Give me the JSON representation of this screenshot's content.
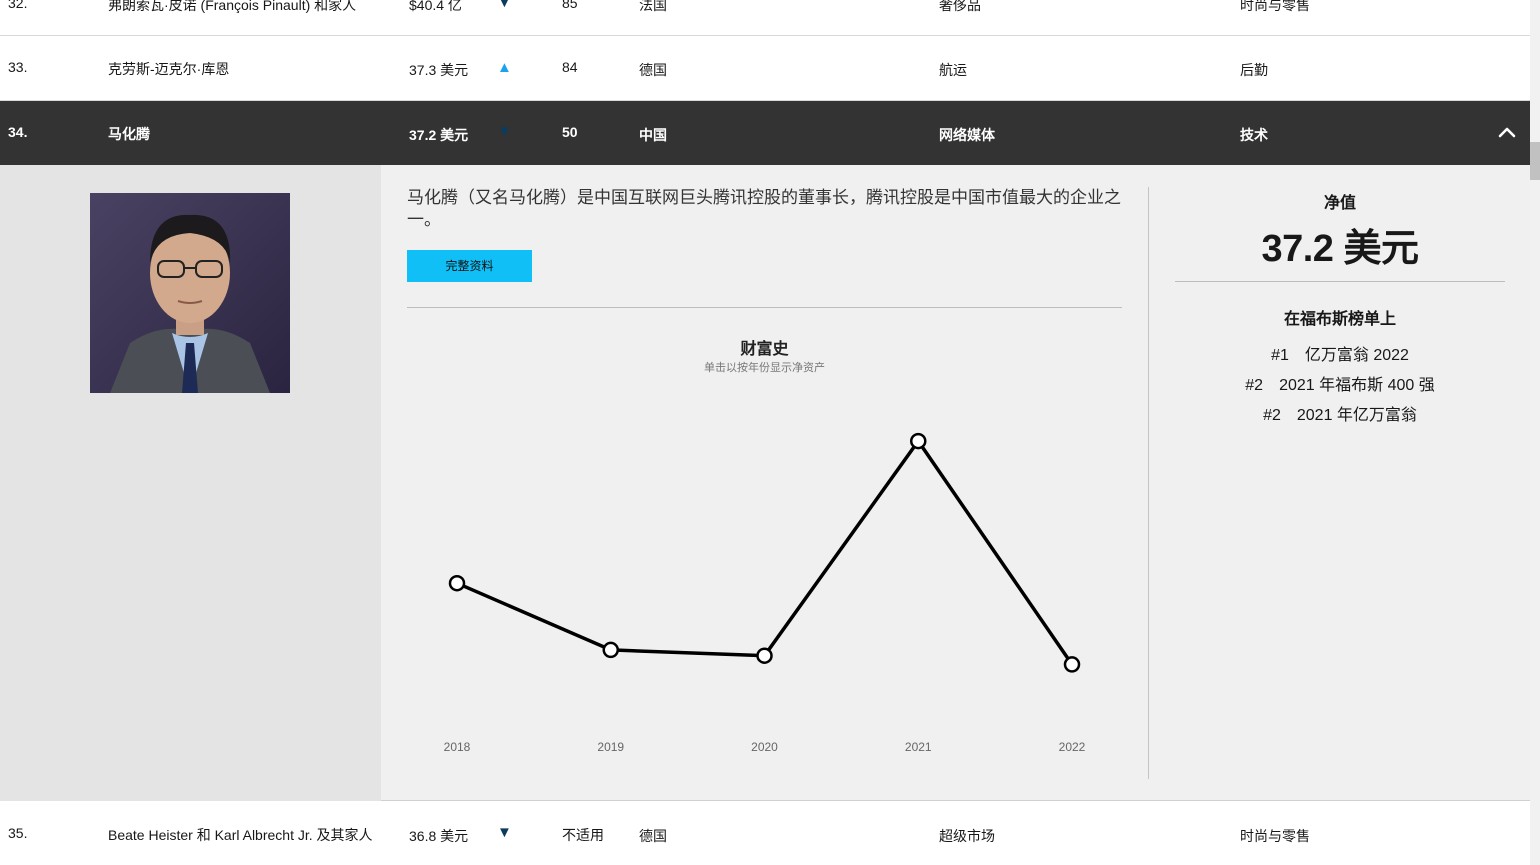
{
  "rows": [
    {
      "rank": "32.",
      "name": "弗朗索瓦·皮诺 (François Pinault) 和家人",
      "worth": "$40.4 亿",
      "trend": "▼",
      "age": "85",
      "country": "法国",
      "source": "奢侈品",
      "industry": "时尚与零售"
    },
    {
      "rank": "33.",
      "name": "克劳斯-迈克尔·库恩",
      "worth": "37.3 美元",
      "trend": "▲",
      "age": "84",
      "country": "德国",
      "source": "航运",
      "industry": "后勤"
    },
    {
      "rank": "34.",
      "name": "马化腾",
      "worth": "37.2 美元",
      "trend": "▼",
      "age": "50",
      "country": "中国",
      "source": "网络媒体",
      "industry": "技术"
    },
    {
      "rank": "35.",
      "name": "Beate Heister 和 Karl Albrecht Jr. 及其家人",
      "worth": "36.8 美元",
      "trend": "▼",
      "age": "不适用",
      "country": "德国",
      "source": "超级市场",
      "industry": "时尚与零售"
    }
  ],
  "detail": {
    "bio": "马化腾（又名马化腾）是中国互联网巨头腾讯控股的董事长，腾讯控股是中国市值最大的企业之一。",
    "profile_button": "完整资料",
    "net_worth_label": "净值",
    "net_worth_value": "37.2 美元",
    "rankings_heading": "在福布斯榜单上",
    "rankings": [
      {
        "rank": "#1",
        "list": "亿万富翁 2022"
      },
      {
        "rank": "#2",
        "list": "2021 年福布斯 400 强"
      },
      {
        "rank": "#2",
        "list": "2021 年亿万富翁"
      }
    ]
  },
  "chart_data": {
    "type": "line",
    "title": "财富史",
    "subtitle": "单击以按年份显示净资产",
    "x": [
      "2018",
      "2019",
      "2020",
      "2021",
      "2022"
    ],
    "series": [
      {
        "values": [
          0.42,
          0.19,
          0.17,
          0.91,
          0.14
        ]
      }
    ],
    "note": "values are relative heights; y-axis unlabeled"
  },
  "colors": {
    "selected_row": "#333333",
    "accent_button": "#0fbff5",
    "arrow_up": "#1da1f2",
    "arrow_down": "#0b3c5d"
  }
}
